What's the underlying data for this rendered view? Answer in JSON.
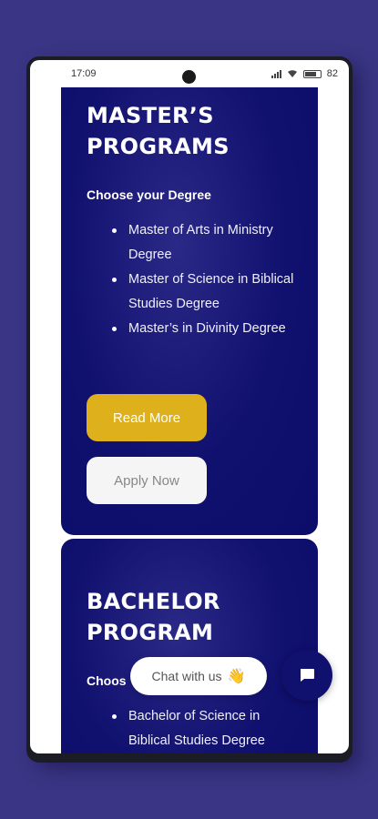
{
  "status_bar": {
    "time": "17:09",
    "battery": "82"
  },
  "masters": {
    "title": "MASTER’S PROGRAMS",
    "subtitle": "Choose your Degree",
    "items": [
      "Master of Arts in Ministry Degree",
      "Master of Science in Biblical Studies Degree",
      "Master’s in Divinity Degree"
    ],
    "read_more": "Read More",
    "apply_now": "Apply Now"
  },
  "bachelor": {
    "title": "BACHELOR PROGRAM",
    "subtitle_partial": "Choos",
    "items": [
      "Bachelor of Science in Biblical Studies Degree"
    ]
  },
  "chat": {
    "label": "Chat with us",
    "emoji": "👋"
  },
  "colors": {
    "background": "#3a3584",
    "card": "#10106f",
    "accent_button": "#ddb01c",
    "secondary_button": "#f5f5f5"
  }
}
